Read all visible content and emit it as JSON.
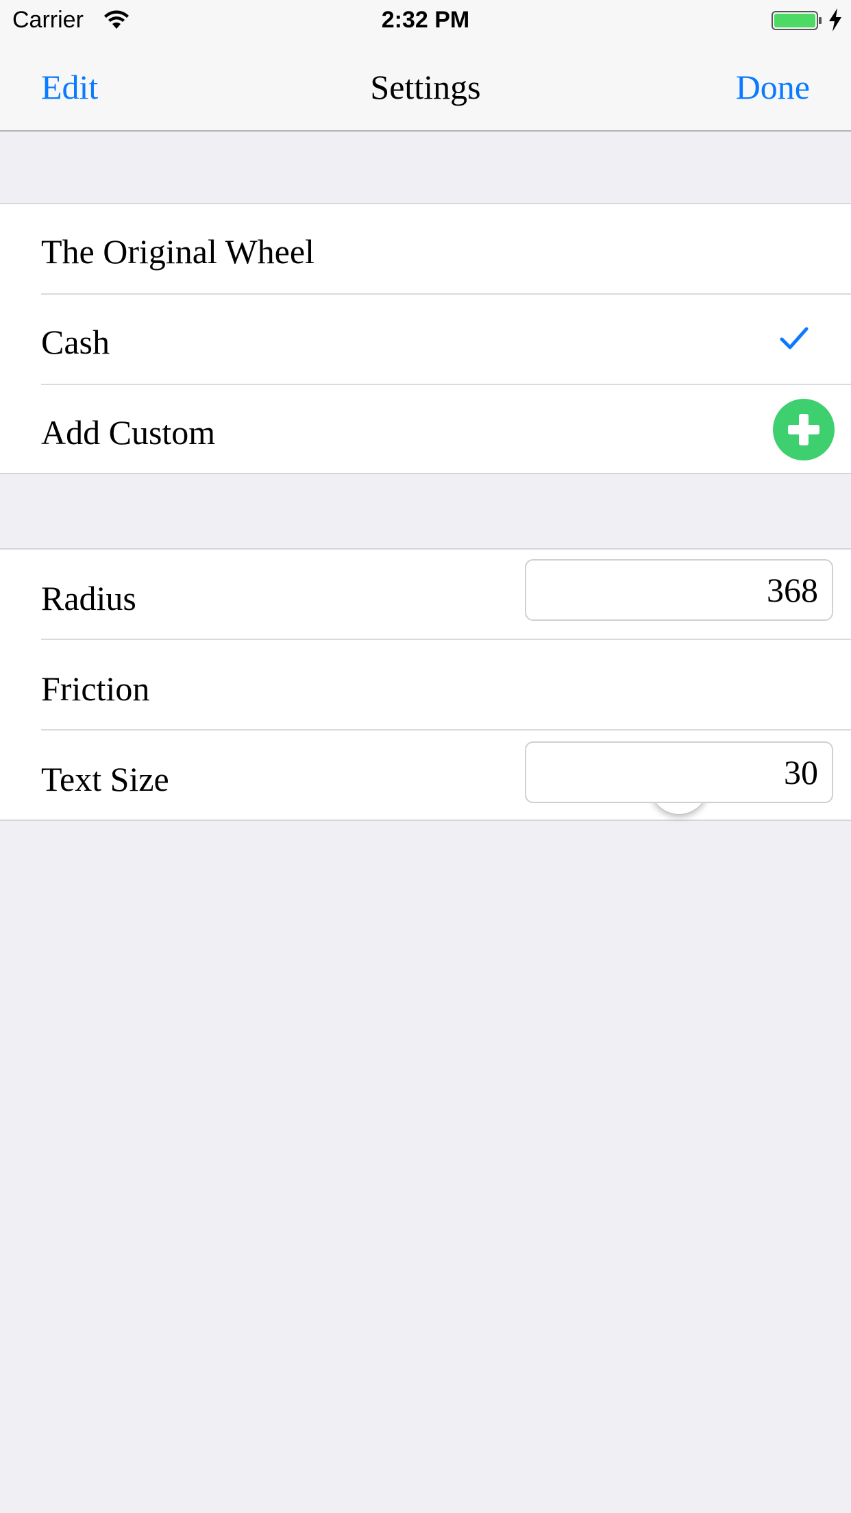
{
  "status_bar": {
    "carrier": "Carrier",
    "time": "2:32 PM",
    "battery_color": "#4cd964"
  },
  "nav": {
    "left_label": "Edit",
    "title": "Settings",
    "right_label": "Done",
    "accent_color": "#0a7aff"
  },
  "wheels": {
    "items": [
      {
        "label": "The Original Wheel",
        "selected": false
      },
      {
        "label": "Cash",
        "selected": true,
        "accessory": "checkmark-icon"
      },
      {
        "label": "Add Custom",
        "accessory": "add-icon"
      }
    ]
  },
  "settings": {
    "radius": {
      "label": "Radius",
      "value": "368"
    },
    "friction": {
      "label": "Friction",
      "level": 0.5
    },
    "text_size": {
      "label": "Text Size",
      "value": "30"
    }
  }
}
